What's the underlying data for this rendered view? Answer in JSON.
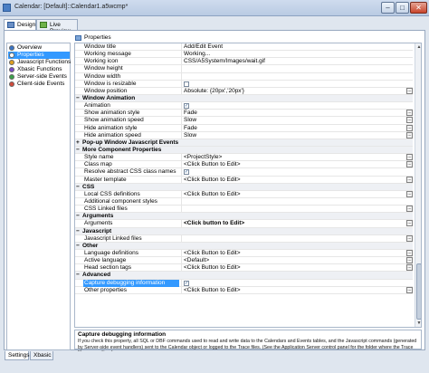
{
  "window": {
    "title": "Calendar: [Default]::Calendar1.a5wcmp*",
    "controls": {
      "minimize": "–",
      "maximize": "□",
      "close": "✕"
    }
  },
  "top_tabs": [
    {
      "label": "Design",
      "icon": "design-icon",
      "active": true
    },
    {
      "label": "Live Preview",
      "icon": "live-preview-icon",
      "active": false
    }
  ],
  "nav": {
    "items": [
      {
        "label": "Overview",
        "icon": "overview-icon",
        "color": "#3a74c4",
        "selected": false
      },
      {
        "label": "Properties",
        "icon": "properties-icon",
        "color": "#ffffff",
        "selected": true
      },
      {
        "label": "Javascript Functions",
        "icon": "javascript-icon",
        "color": "#e0a020",
        "selected": false
      },
      {
        "label": "Xbasic Functions",
        "icon": "xbasic-icon",
        "color": "#7a4bc9",
        "selected": false
      },
      {
        "label": "Server-side Events",
        "icon": "server-events-icon",
        "color": "#3aa04a",
        "selected": false
      },
      {
        "label": "Client-side Events",
        "icon": "client-events-icon",
        "color": "#d04a3a",
        "selected": false
      }
    ]
  },
  "properties_panel": {
    "title": "Properties",
    "icon": "properties-icon"
  },
  "grid": {
    "rows": [
      {
        "type": "prop",
        "name": "Window title",
        "value": "Add/Edit Event"
      },
      {
        "type": "prop",
        "name": "Working message",
        "value": "Working..."
      },
      {
        "type": "prop",
        "name": "Working icon",
        "value": "CSS/A5System/Images/wait.gif"
      },
      {
        "type": "prop",
        "name": "Window height",
        "value": ""
      },
      {
        "type": "prop",
        "name": "Window width",
        "value": ""
      },
      {
        "type": "prop",
        "name": "Window is resizable",
        "value": "",
        "checkbox": true,
        "checked": false
      },
      {
        "type": "prop",
        "name": "Window position",
        "value": "Absolute: {20px','20px'}",
        "button": true
      },
      {
        "type": "cat",
        "name": "Window Animation",
        "expander": "−"
      },
      {
        "type": "prop",
        "name": "Animation",
        "value": "",
        "checkbox": true,
        "checked": true
      },
      {
        "type": "prop",
        "name": "Show animation style",
        "value": "Fade",
        "button": true
      },
      {
        "type": "prop",
        "name": "Show animation speed",
        "value": "Slow",
        "button": true
      },
      {
        "type": "prop",
        "name": "Hide animation style",
        "value": "Fade",
        "button": true
      },
      {
        "type": "prop",
        "name": "Hide animation speed",
        "value": "Slow",
        "button": true
      },
      {
        "type": "cat",
        "name": "Pop-up Window Javascript Events",
        "expander": "+"
      },
      {
        "type": "cat",
        "name": "More Component Properties",
        "expander": "−"
      },
      {
        "type": "prop",
        "name": "Style name",
        "value": "<ProjectStyle>",
        "button": true
      },
      {
        "type": "prop",
        "name": "Class map",
        "value": "<Click Button to Edit>",
        "button": true
      },
      {
        "type": "prop",
        "name": "Resolve abstract CSS class names",
        "value": "",
        "checkbox": true,
        "checked": true
      },
      {
        "type": "prop",
        "name": "Master template",
        "value": "<Click Button to Edit>",
        "button": true
      },
      {
        "type": "cat",
        "name": "CSS",
        "expander": "−"
      },
      {
        "type": "prop",
        "name": "Local CSS definitions",
        "value": "<Click Button to Edit>",
        "button": true
      },
      {
        "type": "prop",
        "name": "Additional component styles",
        "value": ""
      },
      {
        "type": "prop",
        "name": "CSS Linked files",
        "value": "",
        "button": true
      },
      {
        "type": "cat",
        "name": "Arguments",
        "expander": "−"
      },
      {
        "type": "prop",
        "name": "Arguments",
        "value": "<Click button to Edit>",
        "bold_value": true,
        "button": true
      },
      {
        "type": "cat",
        "name": "Javascript",
        "expander": "−"
      },
      {
        "type": "prop",
        "name": "Javascript Linked files",
        "value": "",
        "button": true
      },
      {
        "type": "cat",
        "name": "Other",
        "expander": "−"
      },
      {
        "type": "prop",
        "name": "Language definitions",
        "value": "<Click Button to Edit>",
        "button": true
      },
      {
        "type": "prop",
        "name": "Active language",
        "value": "<Default>",
        "button": true
      },
      {
        "type": "prop",
        "name": "Head section tags",
        "value": "<Click Button to Edit>",
        "button": true
      },
      {
        "type": "cat",
        "name": "Advanced",
        "expander": "−"
      },
      {
        "type": "prop",
        "name": "Capture debugging information",
        "value": "",
        "checkbox": true,
        "checked": true,
        "selected": true
      },
      {
        "type": "prop",
        "name": "Other properties",
        "value": "<Click Button to Edit>",
        "button": true
      }
    ],
    "button_label": "...",
    "check_mark": "✓"
  },
  "help": {
    "title": "Capture debugging information",
    "text": "If you check this property, all SQL or DBF commands used to read and write data to the Calendars and Events tables, and the Javascript commands (generated by Server-side event handlers) sent to the Calendar object or logged to the Trace files. (See the Application Server control panel for the folder where the Trace files are written.)"
  },
  "bottom_tabs": [
    {
      "label": "Settings",
      "active": true
    },
    {
      "label": "Xbasic",
      "active": false
    }
  ],
  "scrollbar": {
    "up": "▲",
    "down": "▼"
  }
}
